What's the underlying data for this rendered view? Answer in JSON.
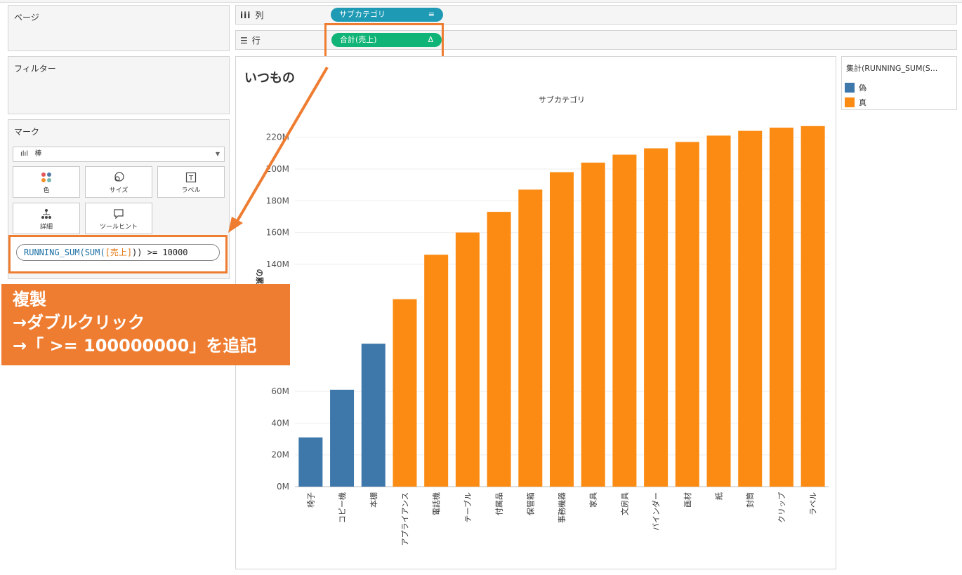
{
  "pages_panel": {
    "title": "ページ"
  },
  "filters_panel": {
    "title": "フィルター"
  },
  "marks_panel": {
    "title": "マーク",
    "mark_type": "棒",
    "buttons": [
      {
        "label": "色",
        "icon": "color-dots-icon"
      },
      {
        "label": "サイズ",
        "icon": "size-icon"
      },
      {
        "label": "ラベル",
        "icon": "label-icon"
      },
      {
        "label": "詳細",
        "icon": "detail-icon"
      },
      {
        "label": "ツールヒント",
        "icon": "tooltip-icon"
      }
    ],
    "formula": {
      "fn_open": "RUNNING_SUM(SUM(",
      "field": "[売上]",
      "rest": ")) >= 10000"
    }
  },
  "shelves": {
    "columns": {
      "label": "列",
      "pill": "サブカテゴリ",
      "pill_color": "#1f9ab5"
    },
    "rows": {
      "label": "行",
      "pill": "合計(売上)",
      "pill_color": "#10b476",
      "delta_icon": "Δ"
    }
  },
  "callout": {
    "line1": "複製",
    "line2": "→ダブルクリック",
    "line3": "→「 >= 100000000」を追記",
    "color": "#ee7d31"
  },
  "sheet": {
    "title": "いつもの"
  },
  "legend": {
    "title": "集計(RUNNING_SUM(S...",
    "items": [
      {
        "label": "偽",
        "color": "#3e77aa"
      },
      {
        "label": "真",
        "color": "#fb8b12"
      }
    ]
  },
  "chart_data": {
    "type": "bar",
    "title": "",
    "top_axis_label": "サブカテゴリ",
    "ylabel": "の累計",
    "ylim": [
      0,
      230
    ],
    "y_unit": "M",
    "y_ticks": [
      "0M",
      "20M",
      "40M",
      "60M",
      "140M",
      "160M",
      "180M",
      "200M",
      "220M"
    ],
    "y_tick_values": [
      0,
      20,
      40,
      60,
      140,
      160,
      180,
      200,
      220
    ],
    "categories": [
      "椅子",
      "コピー機",
      "本棚",
      "アプライアンス",
      "電話機",
      "テーブル",
      "付属品",
      "保管箱",
      "事務機器",
      "家具",
      "文房具",
      "バインダー",
      "画材",
      "紙",
      "封筒",
      "クリップ",
      "ラベル"
    ],
    "values": [
      31,
      61,
      90,
      118,
      146,
      160,
      173,
      187,
      198,
      204,
      209,
      213,
      217,
      221,
      224,
      226,
      227
    ],
    "flags": [
      "偽",
      "偽",
      "偽",
      "真",
      "真",
      "真",
      "真",
      "真",
      "真",
      "真",
      "真",
      "真",
      "真",
      "真",
      "真",
      "真",
      "真"
    ]
  }
}
